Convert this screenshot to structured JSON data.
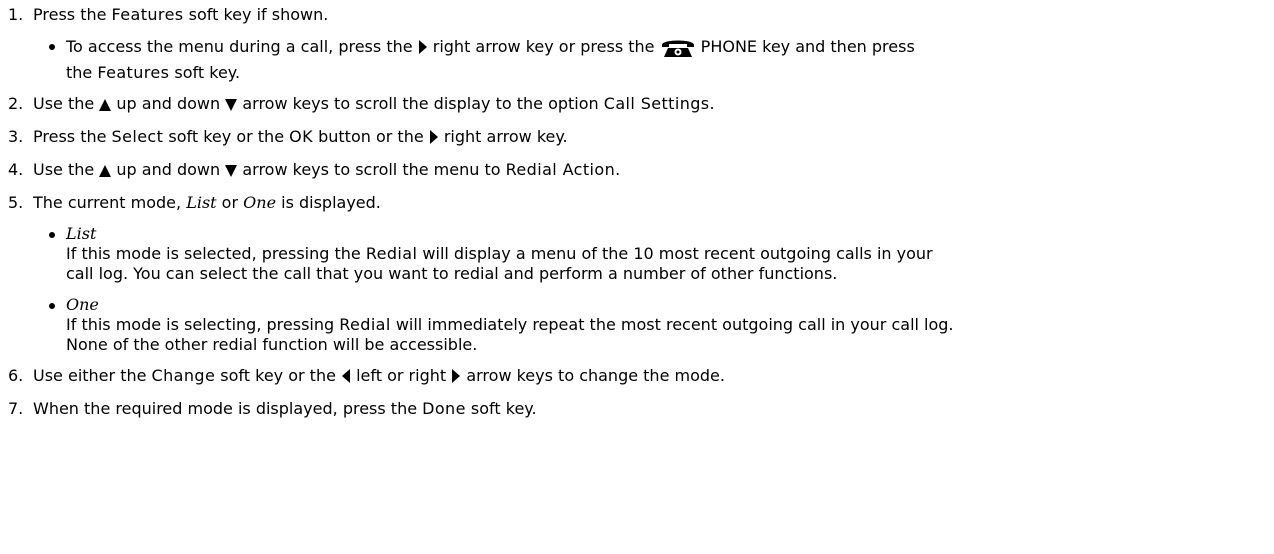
{
  "steps": [
    {
      "num": "1.",
      "parts": [
        "Press the ",
        "Features",
        " soft key if shown."
      ],
      "sub": [
        {
          "a": "To access the menu during a call, press the ",
          "b": " right arrow key or press the ",
          "c": " PHONE key and then press",
          "d": "the ",
          "d_term": "Features",
          "e": " soft key."
        }
      ]
    },
    {
      "num": "2.",
      "a": "Use the ",
      "b": " up and down ",
      "c": " arrow keys to scroll the display to the option ",
      "term": "Call Settings",
      "d": "."
    },
    {
      "num": "3.",
      "a": "Press the ",
      "term1": "Select",
      "b": " soft key or the ",
      "term2": "OK",
      "c": " button or the ",
      "d": " right arrow key."
    },
    {
      "num": "4.",
      "a": "Use the ",
      "b": " up and down ",
      "c": " arrow keys to scroll the menu to ",
      "term": "Redial Action",
      "d": "."
    },
    {
      "num": "5.",
      "a": "The current mode, ",
      "opt1": "List",
      "b": " or ",
      "opt2": "One",
      "c": " is displayed.",
      "options": [
        {
          "name": "List",
          "line1": "If this mode is selected, pressing the ",
          "term": "Redial",
          "line1b": " will display a menu of the 10 most recent outgoing calls in your",
          "line2": "call log. You can select the call that you want to redial and perform a number of other functions."
        },
        {
          "name": "One",
          "line1": "If this mode is selecting, pressing ",
          "term": "Redial",
          "line1b": " will immediately repeat the most recent outgoing call in your call log.",
          "line2": "None of the other redial function will be accessible."
        }
      ]
    },
    {
      "num": "6.",
      "a": "Use either the ",
      "term": "Change",
      "b": " soft key or the ",
      "c": " left or right ",
      "d": " arrow keys to change the mode."
    },
    {
      "num": "7.",
      "a": "When the required mode is displayed, press the ",
      "term": "Done",
      "b": " soft key."
    }
  ],
  "icons": {
    "right": "right-arrow-key-icon",
    "left": "left-arrow-key-icon",
    "up": "up-arrow-key-icon",
    "down": "down-arrow-key-icon",
    "phone": "phone-key-icon"
  }
}
